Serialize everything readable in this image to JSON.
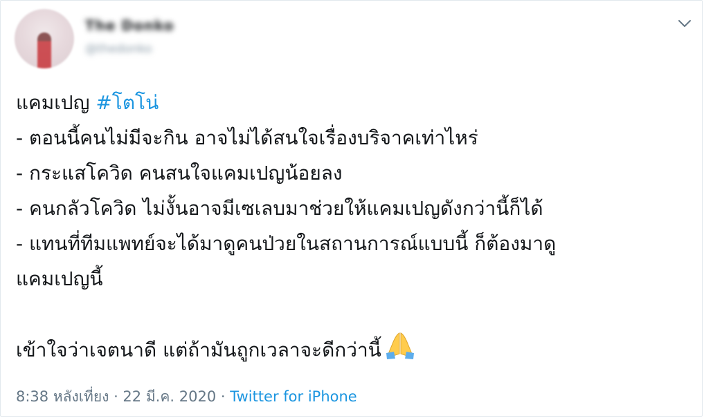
{
  "author": {
    "display_name": "The Donko",
    "handle": "@thedonko"
  },
  "tweet": {
    "hashtag_prefix": "แคมเปญ ",
    "hashtag": "#โตโน่",
    "lines": [
      "- ตอนนี้คนไม่มีจะกิน อาจไม่ได้สนใจเรื่องบริจาคเท่าไหร่",
      "- กระแสโควิด คนสนใจแคมเปญน้อยลง",
      "- คนกลัวโควิด ไม่งั้นอาจมีเซเลบมาช่วยให้แคมเปญดังกว่านี้ก็ได้",
      "- แทนที่ทีมแพทย์จะได้มาดูคนป่วยในสถานการณ์แบบนี้ ก็ต้องมาดู",
      "แคมเปญนี้"
    ],
    "closing": "เข้าใจว่าเจตนาดี แต่ถ้ามันถูกเวลาจะดีกว่านี้"
  },
  "footer": {
    "time": "8:38 หลังเที่ยง",
    "separator1": " · ",
    "date": "22 มี.ค. 2020",
    "separator2": " · ",
    "source": "Twitter for iPhone"
  },
  "icons": {
    "caret": "chevron-down-icon",
    "emoji": "folded-hands-emoji"
  },
  "colors": {
    "link": "#1b95e0",
    "meta": "#657786",
    "text": "#14171a",
    "border": "#e1e8ed"
  }
}
